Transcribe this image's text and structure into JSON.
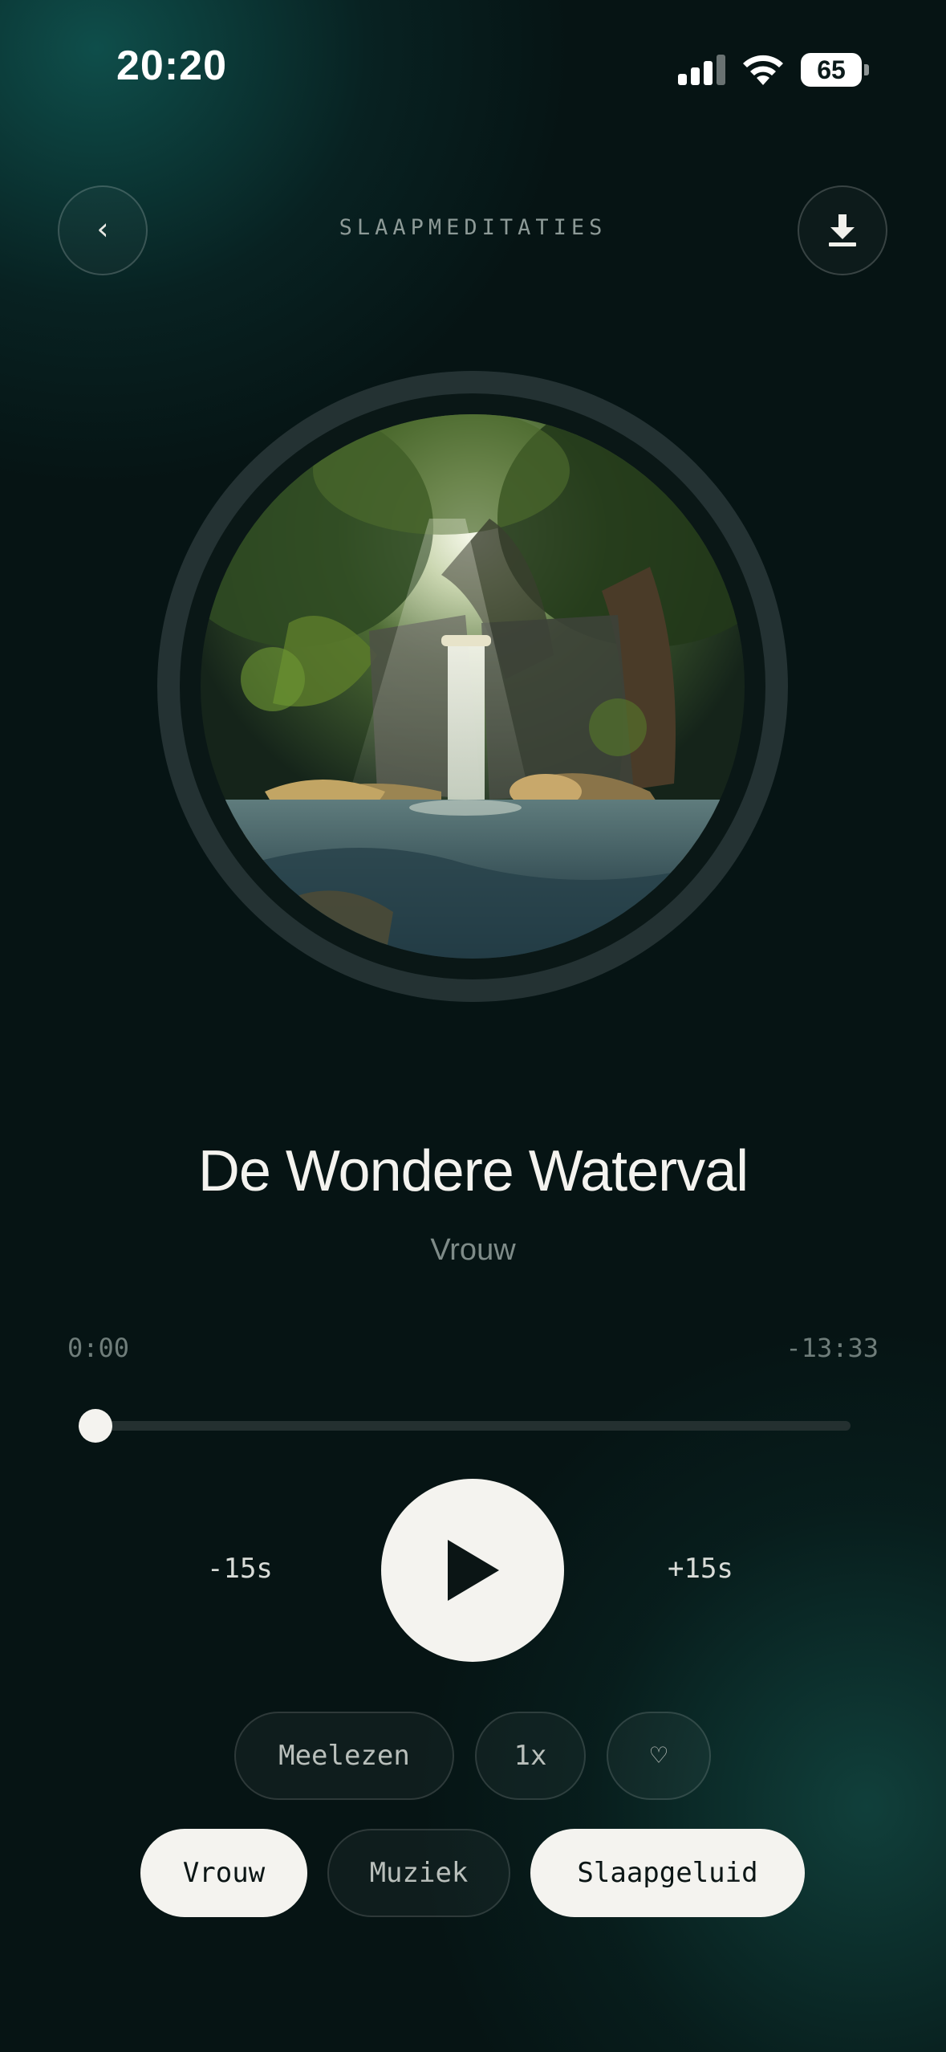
{
  "status_bar": {
    "time": "20:20",
    "battery": "65"
  },
  "header": {
    "title": "SLAAPMEDITATIES",
    "back_label": "‹"
  },
  "track": {
    "title": "De Wondere Waterval",
    "subtitle": "Vrouw"
  },
  "player": {
    "elapsed": "0:00",
    "remaining": "-13:33",
    "progress_fraction": 0.0,
    "skip_back": "-15s",
    "skip_forward": "+15s"
  },
  "options": {
    "read_along": "Meelezen",
    "speed": "1x",
    "favorite": "♡"
  },
  "voice_options": [
    {
      "label": "Vrouw",
      "active": true
    },
    {
      "label": "Muziek",
      "active": false
    },
    {
      "label": "Slaapgeluid",
      "active": true
    }
  ],
  "colors": {
    "background": "#061414",
    "accent_glow": "#105854",
    "foreground": "#f4f3ef"
  }
}
